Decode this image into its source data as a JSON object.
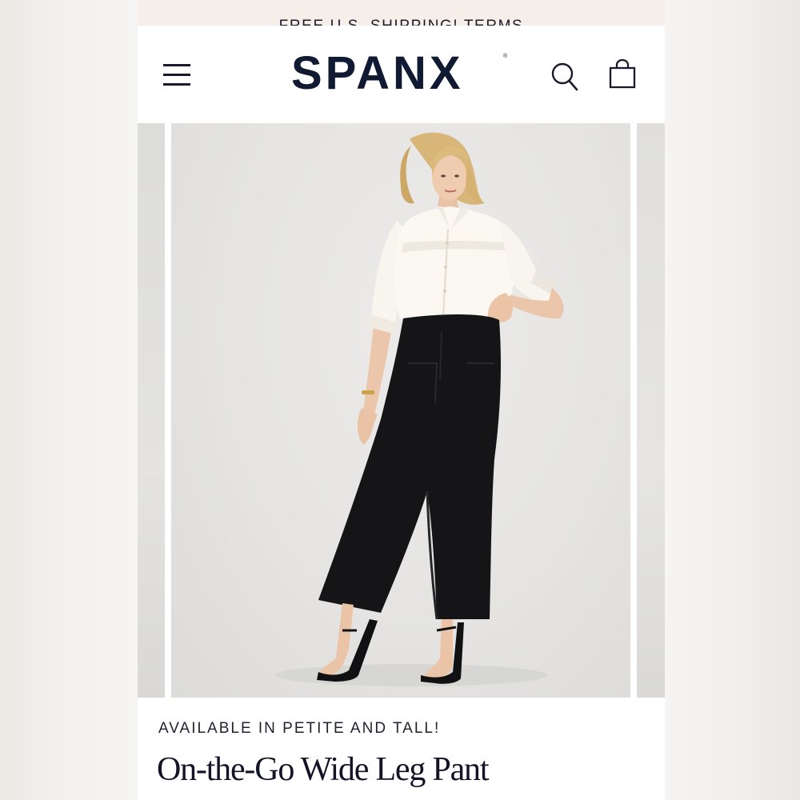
{
  "promo": {
    "text": "FREE U.S. SHIPPING! TERMS"
  },
  "header": {
    "brand": "SPANX",
    "brand_mark": "®",
    "menu_icon": "hamburger-menu-icon",
    "search_icon": "search-icon",
    "bag_icon": "shopping-bag-icon"
  },
  "product": {
    "eyebrow": "AVAILABLE IN PETITE AND TALL!",
    "title": "On-the-Go Wide Leg Pant"
  },
  "colors": {
    "brand_navy": "#111a33",
    "promo_bg": "#f6eee8",
    "text_dark": "#141428"
  }
}
